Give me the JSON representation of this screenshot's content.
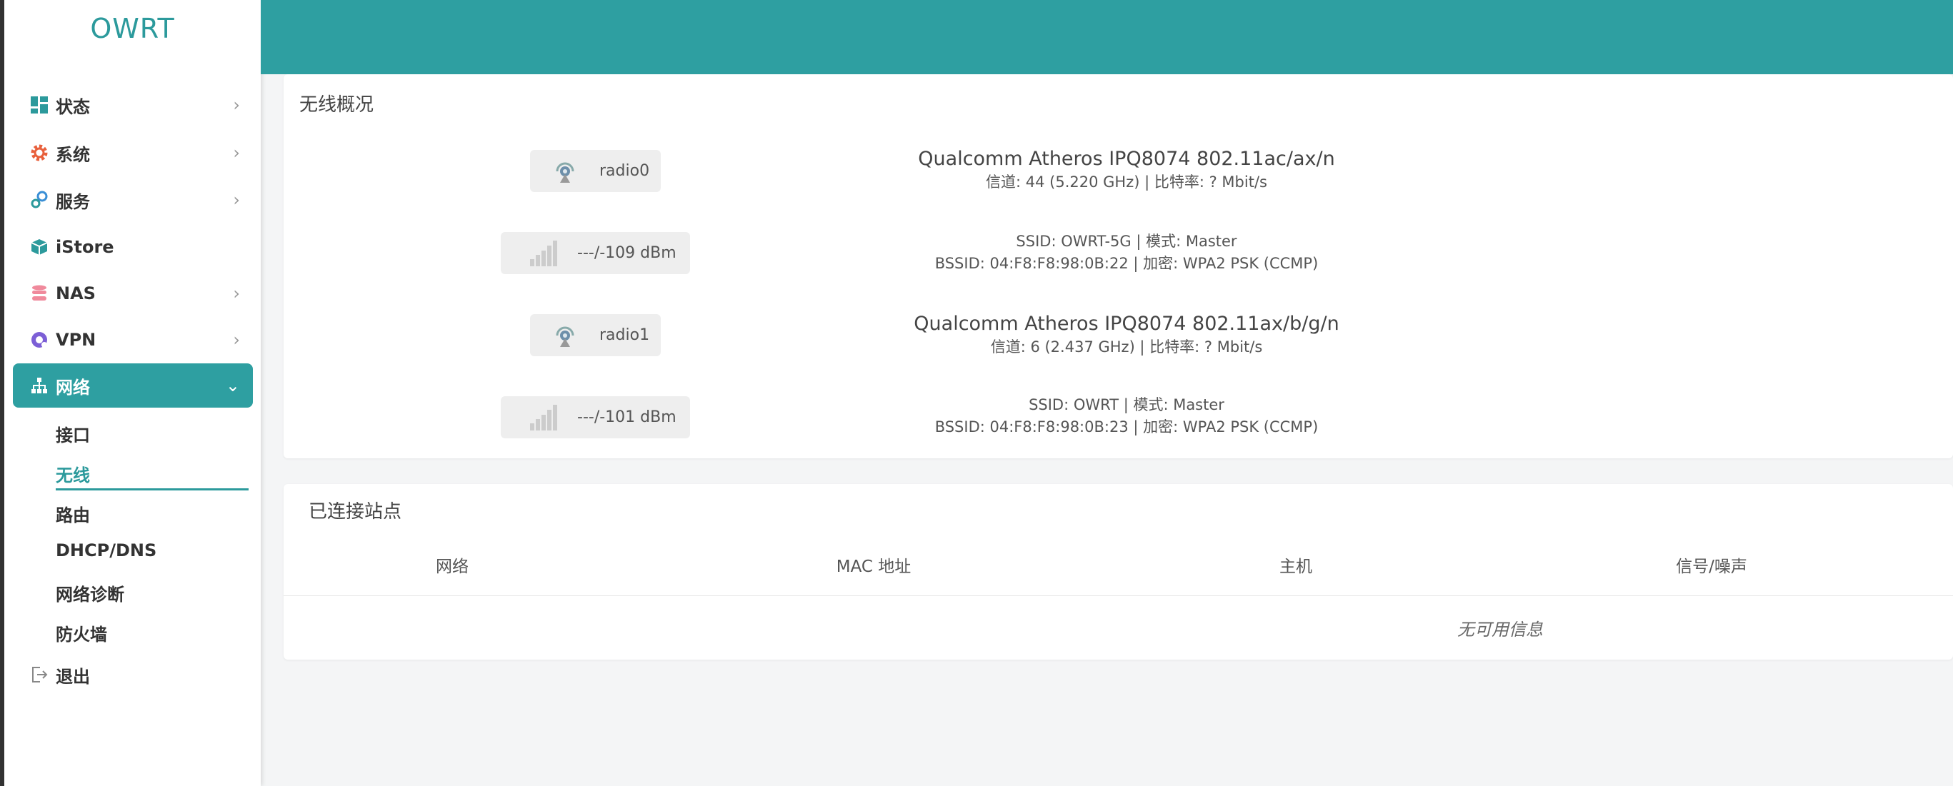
{
  "app": {
    "brand": "OWRT"
  },
  "sidebar": {
    "menu": [
      {
        "label": "状态",
        "icon": "dashboard-icon",
        "expandable": true
      },
      {
        "label": "系统",
        "icon": "gear-icon",
        "expandable": true
      },
      {
        "label": "服务",
        "icon": "services-icon",
        "expandable": true
      },
      {
        "label": "iStore",
        "icon": "cube-icon",
        "expandable": false
      },
      {
        "label": "NAS",
        "icon": "database-icon",
        "expandable": true
      },
      {
        "label": "VPN",
        "icon": "vpn-icon",
        "expandable": true
      },
      {
        "label": "网络",
        "icon": "network-icon",
        "expandable": true,
        "active": true
      },
      {
        "label": "退出",
        "icon": "logout-icon",
        "expandable": false
      }
    ],
    "network_submenu": [
      {
        "label": "接口"
      },
      {
        "label": "无线",
        "selected": true
      },
      {
        "label": "路由"
      },
      {
        "label": "DHCP/DNS"
      },
      {
        "label": "网络诊断"
      },
      {
        "label": "防火墙"
      }
    ]
  },
  "overview": {
    "title": "无线概况",
    "radios": [
      {
        "name": "radio0",
        "hardware": "Qualcomm Atheros IPQ8074 802.11ac/ax/n",
        "channel_info": "信道: 44 (5.220 GHz) | 比特率: ? Mbit/s",
        "signal": "---/-109 dBm",
        "ssid_info": "SSID: OWRT-5G | 模式: Master",
        "bssid_info": "BSSID: 04:F8:F8:98:0B:22 | 加密: WPA2 PSK (CCMP)"
      },
      {
        "name": "radio1",
        "hardware": "Qualcomm Atheros IPQ8074 802.11ax/b/g/n",
        "channel_info": "信道: 6 (2.437 GHz) | 比特率: ? Mbit/s",
        "signal": "---/-101 dBm",
        "ssid_info": "SSID: OWRT | 模式: Master",
        "bssid_info": "BSSID: 04:F8:F8:98:0B:23 | 加密: WPA2 PSK (CCMP)"
      }
    ]
  },
  "stations": {
    "title": "已连接站点",
    "columns": [
      "网络",
      "MAC 地址",
      "主机",
      "信号/噪声"
    ],
    "empty_text": "无可用信息"
  },
  "colors": {
    "accent": "#2e9fa1",
    "brand_text": "#2c9a9c"
  }
}
